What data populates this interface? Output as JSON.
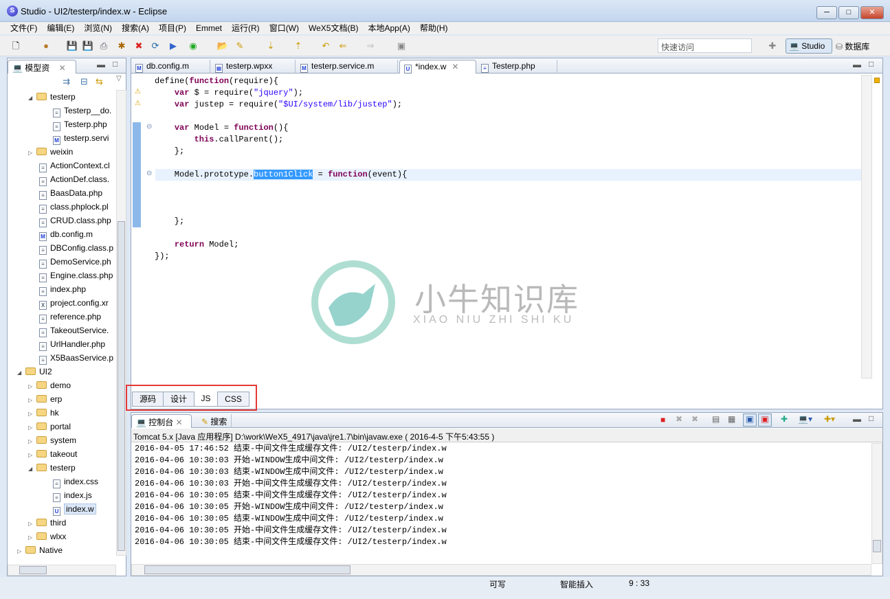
{
  "window": {
    "title": "Studio - UI2/testerp/index.w - Eclipse",
    "app_icon": "S"
  },
  "menu": [
    "文件(F)",
    "编辑(E)",
    "浏览(N)",
    "搜索(A)",
    "项目(P)",
    "Emmet",
    "运行(R)",
    "窗口(W)",
    "WeX5文档(B)",
    "本地App(A)",
    "帮助(H)"
  ],
  "toolbar": {
    "quick_access_placeholder": "快速访问",
    "perspective_studio": "Studio",
    "perspective_db": "数据库"
  },
  "left_panel": {
    "title": "模型资",
    "tree": [
      {
        "label": "testerp",
        "level": 1,
        "type": "folder",
        "expanded": true
      },
      {
        "label": "Testerp__do.",
        "level": 2,
        "type": "file"
      },
      {
        "label": "Testerp.php",
        "level": 2,
        "type": "file"
      },
      {
        "label": "testerp.servi",
        "level": 2,
        "type": "m"
      },
      {
        "label": "weixin",
        "level": 1,
        "type": "folder",
        "expanded": false
      },
      {
        "label": "ActionContext.cl",
        "level": 1,
        "type": "file"
      },
      {
        "label": "ActionDef.class.",
        "level": 1,
        "type": "file"
      },
      {
        "label": "BaasData.php",
        "level": 1,
        "type": "file"
      },
      {
        "label": "class.phplock.pl",
        "level": 1,
        "type": "file"
      },
      {
        "label": "CRUD.class.php",
        "level": 1,
        "type": "file"
      },
      {
        "label": "db.config.m",
        "level": 1,
        "type": "m"
      },
      {
        "label": "DBConfig.class.p",
        "level": 1,
        "type": "file"
      },
      {
        "label": "DemoService.ph",
        "level": 1,
        "type": "file"
      },
      {
        "label": "Engine.class.php",
        "level": 1,
        "type": "file"
      },
      {
        "label": "index.php",
        "level": 1,
        "type": "file"
      },
      {
        "label": "project.config.xr",
        "level": 1,
        "type": "x"
      },
      {
        "label": "reference.php",
        "level": 1,
        "type": "file"
      },
      {
        "label": "TakeoutService.",
        "level": 1,
        "type": "file"
      },
      {
        "label": "UrlHandler.php",
        "level": 1,
        "type": "file"
      },
      {
        "label": "X5BaasService.p",
        "level": 1,
        "type": "file"
      },
      {
        "label": "UI2",
        "level": 0,
        "type": "project",
        "expanded": true
      },
      {
        "label": "demo",
        "level": 1,
        "type": "folder",
        "expanded": false
      },
      {
        "label": "erp",
        "level": 1,
        "type": "folder",
        "expanded": false
      },
      {
        "label": "hk",
        "level": 1,
        "type": "folder",
        "expanded": false
      },
      {
        "label": "portal",
        "level": 1,
        "type": "folder",
        "expanded": false
      },
      {
        "label": "system",
        "level": 1,
        "type": "folder",
        "expanded": false
      },
      {
        "label": "takeout",
        "level": 1,
        "type": "folder",
        "expanded": false
      },
      {
        "label": "testerp",
        "level": 1,
        "type": "folder",
        "expanded": true
      },
      {
        "label": "index.css",
        "level": 2,
        "type": "file"
      },
      {
        "label": "index.js",
        "level": 2,
        "type": "file"
      },
      {
        "label": "index.w",
        "level": 2,
        "type": "u",
        "selected": true
      },
      {
        "label": "third",
        "level": 1,
        "type": "folder",
        "expanded": false
      },
      {
        "label": "wlxx",
        "level": 1,
        "type": "folder",
        "expanded": false
      },
      {
        "label": "Native",
        "level": 0,
        "type": "project",
        "expanded": false
      }
    ]
  },
  "editor": {
    "tabs": [
      {
        "label": "db.config.m",
        "icon": "M"
      },
      {
        "label": "testerp.wpxx",
        "icon": "grid"
      },
      {
        "label": "testerp.service.m",
        "icon": "M"
      },
      {
        "label": "*index.w",
        "icon": "U",
        "active": true
      },
      {
        "label": "Testerp.php",
        "icon": "file"
      }
    ],
    "code": [
      [
        [
          "",
          "define("
        ],
        [
          "kw",
          "function"
        ],
        [
          "",
          "(require){"
        ]
      ],
      [
        [
          "",
          "    "
        ],
        [
          "kw",
          "var"
        ],
        [
          "",
          " $ = require("
        ],
        [
          "str",
          "\"jquery\""
        ],
        [
          "",
          ");"
        ]
      ],
      [
        [
          "",
          "    "
        ],
        [
          "kw",
          "var"
        ],
        [
          "",
          " justep = require("
        ],
        [
          "str",
          "\"$UI/system/lib/justep\""
        ],
        [
          "",
          ");"
        ]
      ],
      [
        [
          "",
          ""
        ]
      ],
      [
        [
          "",
          "    "
        ],
        [
          "kw",
          "var"
        ],
        [
          "",
          " Model = "
        ],
        [
          "kw",
          "function"
        ],
        [
          "",
          "(){"
        ]
      ],
      [
        [
          "",
          "        "
        ],
        [
          "kw",
          "this"
        ],
        [
          "",
          ".callParent();"
        ]
      ],
      [
        [
          "",
          "    };"
        ]
      ],
      [
        [
          "",
          ""
        ]
      ],
      [
        [
          "",
          "    Model.prototype."
        ],
        [
          "sel",
          "button1Click"
        ],
        [
          "",
          " = "
        ],
        [
          "kw",
          "function"
        ],
        [
          "",
          "(event){"
        ]
      ],
      [
        [
          "",
          ""
        ]
      ],
      [
        [
          "",
          ""
        ]
      ],
      [
        [
          "",
          ""
        ]
      ],
      [
        [
          "",
          "    };"
        ]
      ],
      [
        [
          "",
          ""
        ]
      ],
      [
        [
          "",
          "    "
        ],
        [
          "kw",
          "return"
        ],
        [
          "",
          " Model;"
        ]
      ],
      [
        [
          "",
          "});"
        ]
      ]
    ],
    "bottom_tabs": [
      "源码",
      "设计",
      "JS",
      "CSS"
    ],
    "active_bottom_tab": "JS"
  },
  "watermark": {
    "text": "小牛知识库",
    "subtext": "XIAO NIU ZHI SHI KU"
  },
  "console": {
    "tabs": [
      "控制台",
      "搜索"
    ],
    "process": "Tomcat 5.x [Java 应用程序] D:\\work\\WeX5_4917\\java\\jre1.7\\bin\\javaw.exe ( 2016-4-5 下午5:43:55 )",
    "lines": [
      "2016-04-05 17:46:52 结束-中间文件生成缓存文件: /UI2/testerp/index.w",
      "2016-04-06 10:30:03 开始-WINDOW生成中间文件: /UI2/testerp/index.w",
      "2016-04-06 10:30:03 结束-WINDOW生成中间文件: /UI2/testerp/index.w",
      "2016-04-06 10:30:03 开始-中间文件生成缓存文件: /UI2/testerp/index.w",
      "2016-04-06 10:30:05 结束-中间文件生成缓存文件: /UI2/testerp/index.w",
      "2016-04-06 10:30:05 开始-WINDOW生成中间文件: /UI2/testerp/index.w",
      "2016-04-06 10:30:05 结束-WINDOW生成中间文件: /UI2/testerp/index.w",
      "2016-04-06 10:30:05 开始-中间文件生成缓存文件: /UI2/testerp/index.w",
      "2016-04-06 10:30:05 结束-中间文件生成缓存文件: /UI2/testerp/index.w"
    ]
  },
  "status": {
    "writable": "可写",
    "insert_mode": "智能插入",
    "position": "9 : 33"
  },
  "colors": {
    "keyword": "#7f0055",
    "string": "#2a00ff",
    "selection": "#3399ff",
    "highlight_box": "#e53935"
  }
}
